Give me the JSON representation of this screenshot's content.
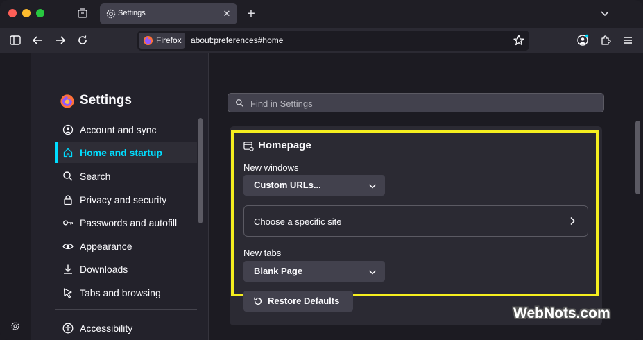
{
  "tab": {
    "title": "Settings"
  },
  "toolbar": {
    "identity_label": "Firefox",
    "url": "about:preferences#home"
  },
  "sidebar": {
    "title": "Settings",
    "items": [
      {
        "label": "Account and sync",
        "icon": "account-icon",
        "active": false
      },
      {
        "label": "Home and startup",
        "icon": "home-icon",
        "active": true
      },
      {
        "label": "Search",
        "icon": "search-icon",
        "active": false
      },
      {
        "label": "Privacy and security",
        "icon": "lock-icon",
        "active": false
      },
      {
        "label": "Passwords and autofill",
        "icon": "key-icon",
        "active": false
      },
      {
        "label": "Appearance",
        "icon": "eye-icon",
        "active": false
      },
      {
        "label": "Downloads",
        "icon": "download-icon",
        "active": false
      },
      {
        "label": "Tabs and browsing",
        "icon": "cursor-icon",
        "active": false
      },
      {
        "label": "Accessibility",
        "icon": "accessibility-icon",
        "active": false
      }
    ]
  },
  "search": {
    "placeholder": "Find in Settings"
  },
  "homepage": {
    "title": "Homepage",
    "new_windows_label": "New windows",
    "new_windows_value": "Custom URLs...",
    "choose_site_label": "Choose a specific site",
    "new_tabs_label": "New tabs",
    "new_tabs_value": "Blank Page",
    "restore_label": "Restore Defaults"
  },
  "watermark": "WebNots.com",
  "colors": {
    "accent": "#00ddff",
    "highlight": "#f5ee1f"
  }
}
